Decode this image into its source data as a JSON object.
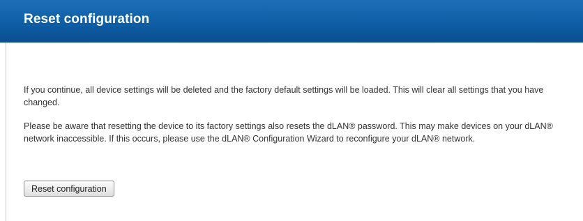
{
  "header": {
    "title": "Reset configuration"
  },
  "content": {
    "paragraph_1": "If you continue, all device settings will be deleted and the factory default settings will be loaded. This will clear all settings that you have changed.",
    "paragraph_2": "Please be aware that resetting the device to its factory settings also resets the dLAN® password. This may make devices on your dLAN® network inaccessible. If this occurs, please use the dLAN® Configuration Wizard to reconfigure your dLAN® network."
  },
  "actions": {
    "reset_label": "Reset configuration"
  },
  "colors": {
    "header_bg": "#0f5ea6",
    "header_text": "#ffffff",
    "body_text": "#333333"
  }
}
